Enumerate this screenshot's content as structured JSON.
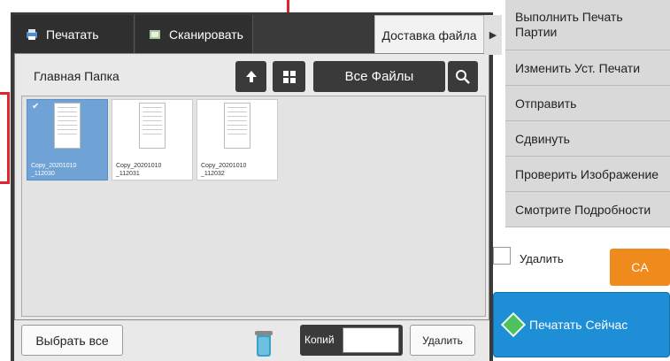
{
  "tabs": {
    "print": "Печатать",
    "scan": "Сканировать",
    "delivery": "Доставка файла"
  },
  "folder": {
    "label": "Главная Папка",
    "all_files": "Все Файлы"
  },
  "files": [
    {
      "name": "Copy_20201010\n_112030",
      "selected": true
    },
    {
      "name": "Copy_20201010\n_112031",
      "selected": false
    },
    {
      "name": "Copy_20201010\n_112032",
      "selected": false
    }
  ],
  "bottom": {
    "select_all": "Выбрать все",
    "copies_label": "Копий",
    "copies_value": "",
    "delete": "Удалить"
  },
  "side_menu": {
    "items": [
      "Выполнить Печать Партии",
      "Изменить Уст. Печати",
      "Отправить",
      "Сдвинуть",
      "Проверить Изображение",
      "Смотрите Подробности"
    ]
  },
  "delete_checkbox_label": "Удалить",
  "ca_label": "CA",
  "print_now": "Печатать Сейчас",
  "colors": {
    "accent_blue": "#1e8fd6",
    "ca_orange": "#f08a1c",
    "selected_file": "#6fa3d6",
    "annotation_red": "#e0242b"
  }
}
